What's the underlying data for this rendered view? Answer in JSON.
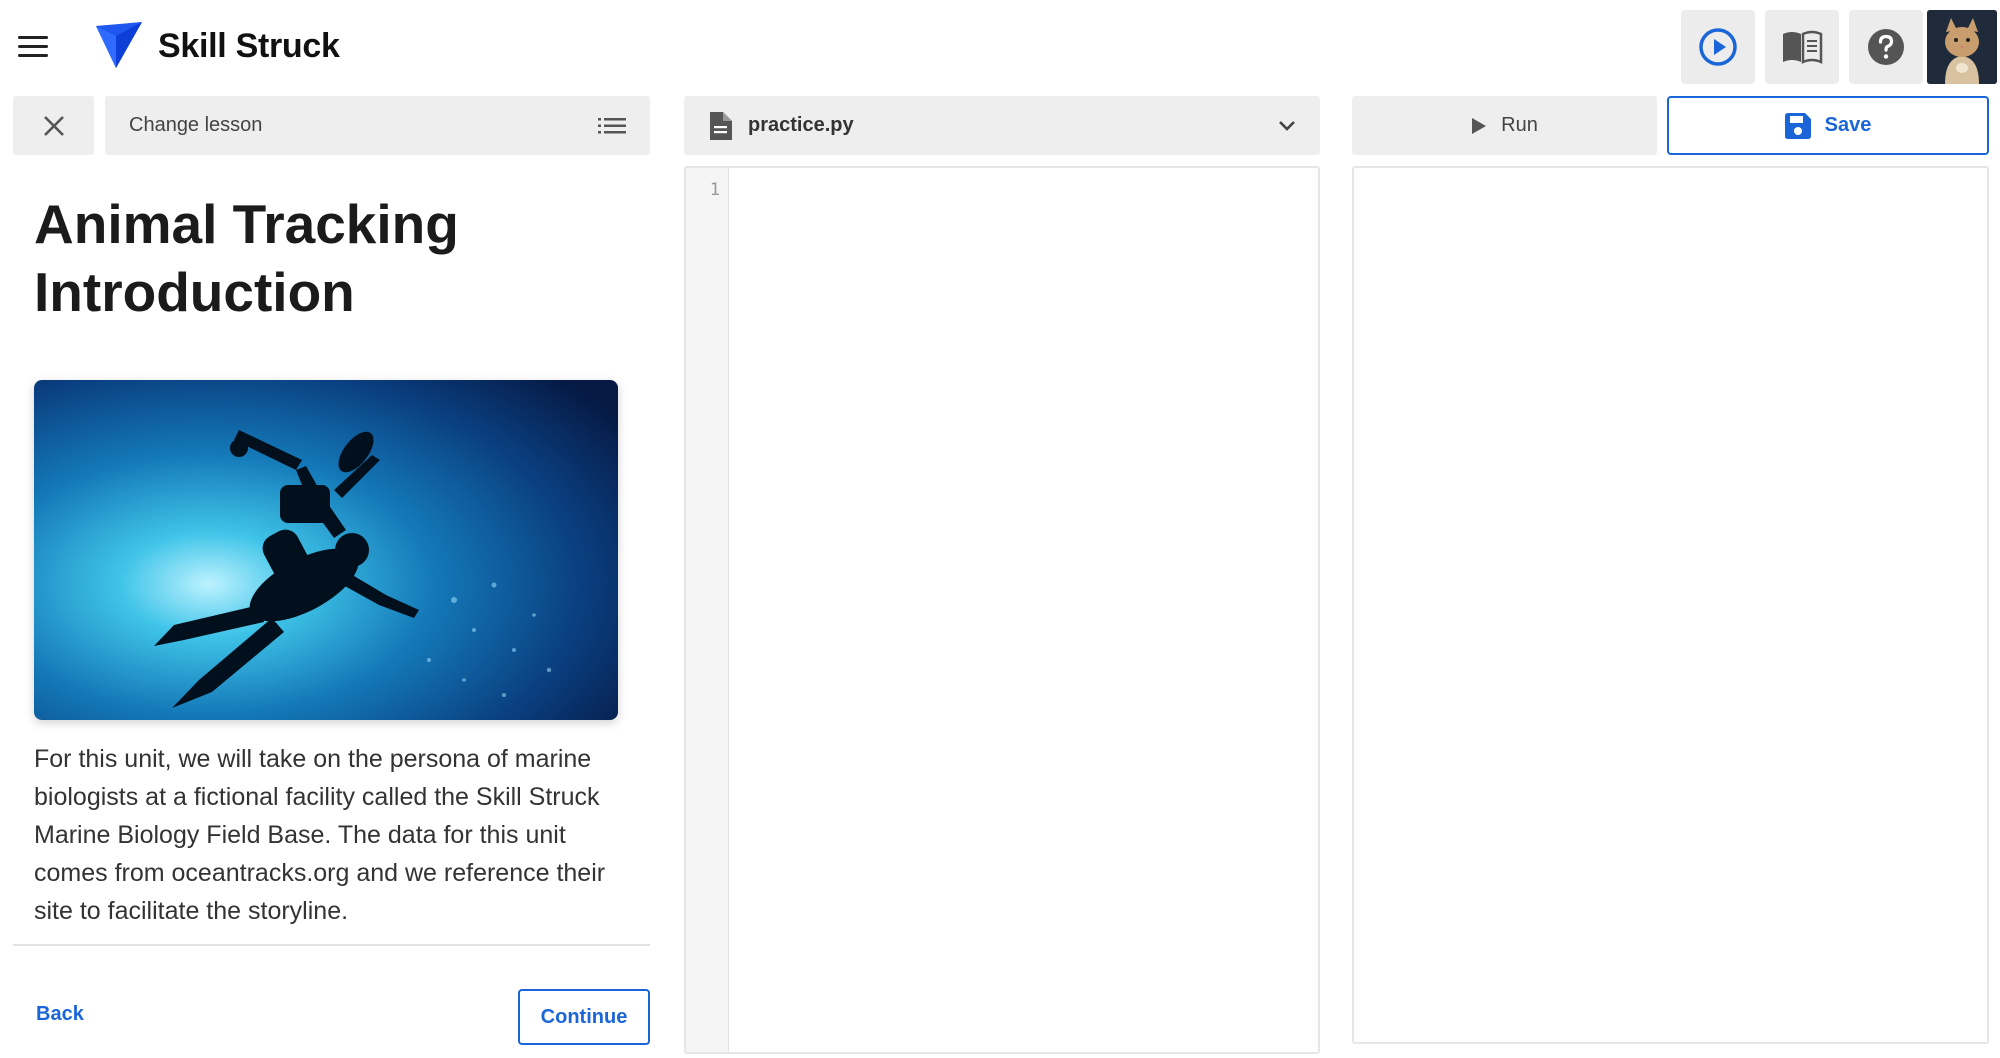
{
  "header": {
    "app_title": "Skill Struck",
    "icons": {
      "menu": "hamburger-menu-icon",
      "logo": "skill-struck-logo-icon",
      "video": "play-circle-icon",
      "book": "book-icon",
      "help": "help-icon",
      "avatar": "cat-avatar"
    },
    "colors": {
      "accent": "#1a66d9",
      "logo": "#1e56f0"
    }
  },
  "lesson": {
    "change_lesson_label": "Change lesson",
    "title": "Animal Tracking Introduction",
    "body": "For this unit, we will take on the persona of marine biologists at a fictional facility called the Skill Struck Marine Biology Field Base.  The data for this unit comes from oceantracks.org and we reference their site to facilitate the storyline.",
    "back_label": "Back",
    "continue_label": "Continue"
  },
  "editor": {
    "file_name": "practice.py",
    "line_numbers": [
      "1"
    ],
    "code": ""
  },
  "output": {
    "run_label": "Run",
    "save_label": "Save"
  }
}
